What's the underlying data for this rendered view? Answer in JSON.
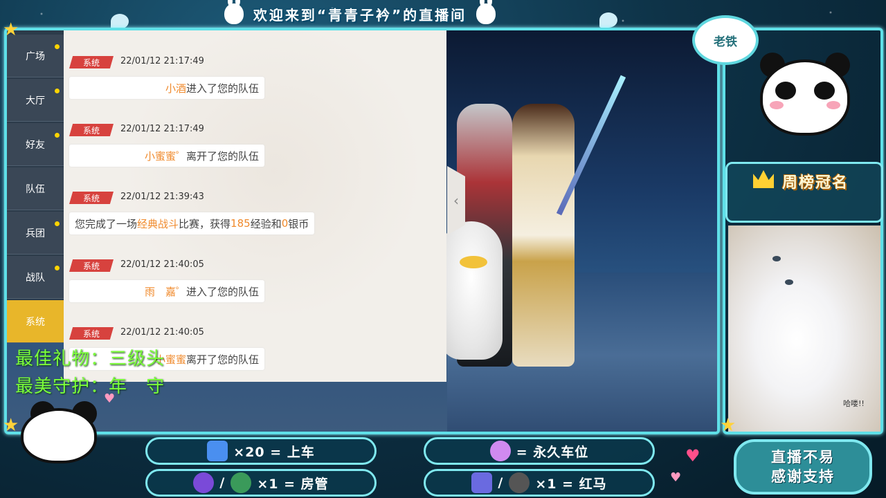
{
  "banner": {
    "title": "欢迎来到“青青子衿”的直播间"
  },
  "sidebar": {
    "items": [
      {
        "label": "广场"
      },
      {
        "label": "大厅"
      },
      {
        "label": "好友"
      },
      {
        "label": "队伍"
      },
      {
        "label": "兵团"
      },
      {
        "label": "战队"
      },
      {
        "label": "系统"
      }
    ],
    "active": "系统"
  },
  "chat": {
    "messages": [
      {
        "tag": "系统",
        "time": "22/01/12 21:17:49",
        "name": "小酒",
        "text": "进入了您的队伍"
      },
      {
        "tag": "系统",
        "time": "22/01/12 21:17:49",
        "name": "小蜜蜜゜",
        "text": "离开了您的队伍"
      },
      {
        "tag": "系统",
        "time": "22/01/12 21:39:43",
        "p1": "您完成了一场",
        "mode": "经典战斗",
        "p2": "比赛，获得",
        "exp": "185",
        "p3": "经验和",
        "coin": "0",
        "p4": "银币"
      },
      {
        "tag": "系统",
        "time": "22/01/12 21:40:05",
        "name": "雨　嘉゜",
        "text": "进入了您的队伍"
      },
      {
        "tag": "系统",
        "time": "22/01/12 21:40:05",
        "name": "小蜜蜜",
        "text": "离开了您的队伍"
      }
    ],
    "collapse_icon": "‹"
  },
  "overlay": {
    "best_gift": "最佳礼物：三级头",
    "best_guard": "最美守护：年　守"
  },
  "right": {
    "speech": "老铁",
    "weekly_title": "周榜冠名",
    "cat_caption": "哈喽!!"
  },
  "legend": {
    "row1_left": "×20 = 上车",
    "row1_right": "= 永久车位",
    "row2_left_sep": "/",
    "row2_left": "×1 = 房管",
    "row2_right_sep": "/",
    "row2_right": "×1 = 红马"
  },
  "thanks": {
    "line1": "直播不易",
    "line2": "感谢支持"
  },
  "colors": {
    "accent": "#5fe0e8",
    "tag": "#d7423e",
    "active": "#e8b62a",
    "highlight": "#f08a2c",
    "overlay_text": "#7cff3a"
  }
}
